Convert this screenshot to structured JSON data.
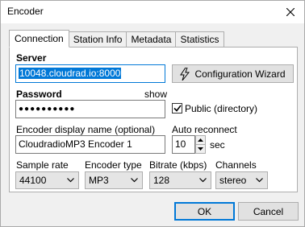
{
  "window": {
    "title": "Encoder",
    "close_glyph": "✕"
  },
  "tabs": [
    {
      "label": "Connection",
      "active": true
    },
    {
      "label": "Station Info",
      "active": false
    },
    {
      "label": "Metadata",
      "active": false
    },
    {
      "label": "Statistics",
      "active": false
    }
  ],
  "connection": {
    "server_label": "Server",
    "server_value": "10048.cloudrad.io:8000",
    "config_wizard_label": "Configuration Wizard",
    "password_label": "Password",
    "show_label": "show",
    "password_value": "●●●●●●●●●●",
    "public_label": "Public (directory)",
    "public_checked": true,
    "display_name_label": "Encoder display name (optional)",
    "display_name_value": "CloudradioMP3 Encoder 1",
    "auto_reconnect_label": "Auto reconnect",
    "auto_reconnect_value": "10",
    "auto_reconnect_unit": "sec",
    "sample_rate_label": "Sample rate",
    "sample_rate_value": "44100",
    "encoder_type_label": "Encoder type",
    "encoder_type_value": "MP3",
    "bitrate_label": "Bitrate (kbps)",
    "bitrate_value": "128",
    "channels_label": "Channels",
    "channels_value": "stereo"
  },
  "footer": {
    "ok_label": "OK",
    "cancel_label": "Cancel"
  }
}
